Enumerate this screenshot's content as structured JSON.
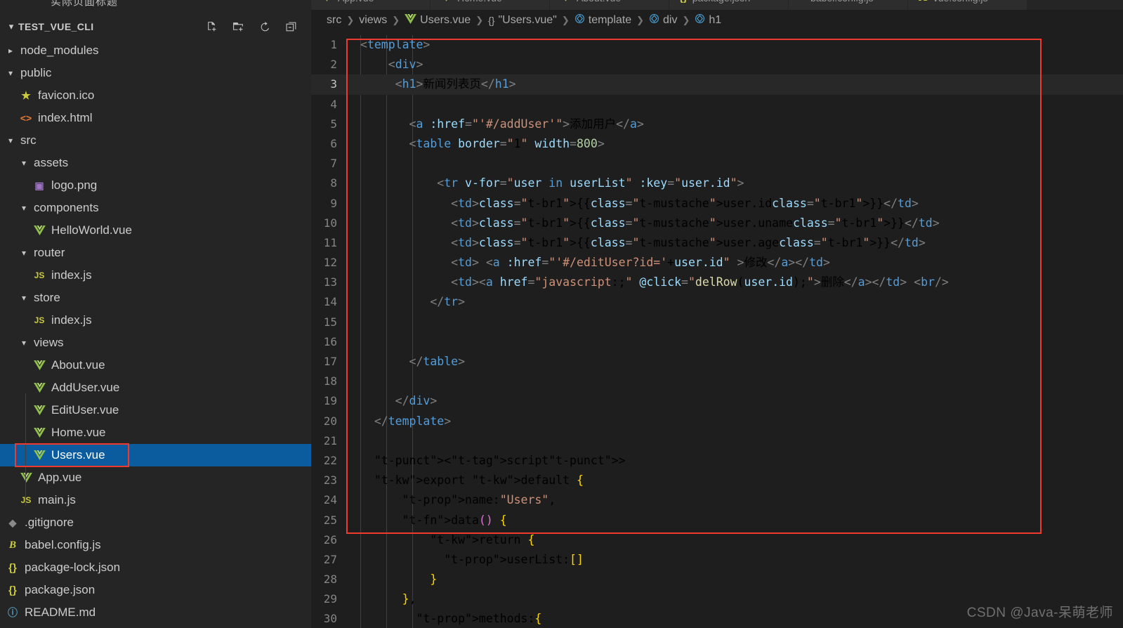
{
  "sidebar": {
    "cut_title": "实际页面标题",
    "project_name": "TEST_VUE_CLI",
    "actions": [
      {
        "name": "new-file",
        "label": "New File"
      },
      {
        "name": "new-folder",
        "label": "New Folder"
      },
      {
        "name": "refresh",
        "label": "Refresh Explorer"
      },
      {
        "name": "collapse",
        "label": "Collapse Folders in Explorer"
      }
    ],
    "items": [
      {
        "label": "node_modules",
        "kind": "folder",
        "expanded": false,
        "depth": 1,
        "icon": "chevron-right-icon"
      },
      {
        "label": "public",
        "kind": "folder",
        "expanded": true,
        "depth": 1,
        "icon": "chevron-down-icon"
      },
      {
        "label": "favicon.ico",
        "kind": "file",
        "depth": 2,
        "icon": "star-icon"
      },
      {
        "label": "index.html",
        "kind": "file",
        "depth": 2,
        "icon": "html-icon"
      },
      {
        "label": "src",
        "kind": "folder",
        "expanded": true,
        "depth": 1,
        "icon": "chevron-down-icon"
      },
      {
        "label": "assets",
        "kind": "folder",
        "expanded": true,
        "depth": 2,
        "icon": "chevron-down-icon"
      },
      {
        "label": "logo.png",
        "kind": "file",
        "depth": 3,
        "icon": "image-icon"
      },
      {
        "label": "components",
        "kind": "folder",
        "expanded": true,
        "depth": 2,
        "icon": "chevron-down-icon"
      },
      {
        "label": "HelloWorld.vue",
        "kind": "file",
        "depth": 3,
        "icon": "vue-icon"
      },
      {
        "label": "router",
        "kind": "folder",
        "expanded": true,
        "depth": 2,
        "icon": "chevron-down-icon"
      },
      {
        "label": "index.js",
        "kind": "file",
        "depth": 3,
        "icon": "js-icon"
      },
      {
        "label": "store",
        "kind": "folder",
        "expanded": true,
        "depth": 2,
        "icon": "chevron-down-icon"
      },
      {
        "label": "index.js",
        "kind": "file",
        "depth": 3,
        "icon": "js-icon"
      },
      {
        "label": "views",
        "kind": "folder",
        "expanded": true,
        "depth": 2,
        "icon": "chevron-down-icon"
      },
      {
        "label": "About.vue",
        "kind": "file",
        "depth": 3,
        "icon": "vue-icon"
      },
      {
        "label": "AddUser.vue",
        "kind": "file",
        "depth": 3,
        "icon": "vue-icon"
      },
      {
        "label": "EditUser.vue",
        "kind": "file",
        "depth": 3,
        "icon": "vue-icon"
      },
      {
        "label": "Home.vue",
        "kind": "file",
        "depth": 3,
        "icon": "vue-icon"
      },
      {
        "label": "Users.vue",
        "kind": "file",
        "depth": 3,
        "icon": "vue-icon",
        "selected": true,
        "annotated": true
      },
      {
        "label": "App.vue",
        "kind": "file",
        "depth": 2,
        "icon": "vue-icon"
      },
      {
        "label": "main.js",
        "kind": "file",
        "depth": 2,
        "icon": "js-icon"
      },
      {
        "label": ".gitignore",
        "kind": "file",
        "depth": 1,
        "icon": "git-icon"
      },
      {
        "label": "babel.config.js",
        "kind": "file",
        "depth": 1,
        "icon": "babel-icon"
      },
      {
        "label": "package-lock.json",
        "kind": "file",
        "depth": 1,
        "icon": "json-icon"
      },
      {
        "label": "package.json",
        "kind": "file",
        "depth": 1,
        "icon": "json-icon"
      },
      {
        "label": "README.md",
        "kind": "file",
        "depth": 1,
        "icon": "markdown-icon"
      }
    ]
  },
  "tabs": [
    {
      "label": "App.vue",
      "icon": "vue-icon",
      "active": false
    },
    {
      "label": "Home.vue",
      "icon": "vue-icon",
      "active": false
    },
    {
      "label": "About.vue",
      "icon": "vue-icon",
      "active": false
    },
    {
      "label": "package.json",
      "icon": "json-icon",
      "active": false
    },
    {
      "label": "babel.config.js",
      "icon": "babel-icon",
      "active": false
    },
    {
      "label": "vue.config.js",
      "icon": "js-icon",
      "active": false
    }
  ],
  "breadcrumb": [
    {
      "label": "src",
      "icon": null
    },
    {
      "label": "views",
      "icon": null
    },
    {
      "label": "Users.vue",
      "icon": "vue-icon"
    },
    {
      "label": "\"Users.vue\"",
      "icon": "json-icon"
    },
    {
      "label": "template",
      "icon": "tag-icon"
    },
    {
      "label": "div",
      "icon": "tag-icon"
    },
    {
      "label": "h1",
      "icon": "tag-icon"
    }
  ],
  "editor": {
    "active_line": 3,
    "lines": [
      {
        "n": 1,
        "text": "<template>"
      },
      {
        "n": 2,
        "text": "    <div>"
      },
      {
        "n": 3,
        "text": "     <h1>新闻列表页</h1>"
      },
      {
        "n": 4,
        "text": ""
      },
      {
        "n": 5,
        "text": "       <a :href=\"'#/addUser'\">添加用户</a>"
      },
      {
        "n": 6,
        "text": "       <table border=\"1\" width=800>"
      },
      {
        "n": 7,
        "text": ""
      },
      {
        "n": 8,
        "text": "           <tr v-for=\"user in userList\" :key=\"user.id\">"
      },
      {
        "n": 9,
        "text": "             <td>{{user.id}}</td>"
      },
      {
        "n": 10,
        "text": "             <td>{{user.uname}}</td>"
      },
      {
        "n": 11,
        "text": "             <td>{{user.age}}</td>"
      },
      {
        "n": 12,
        "text": "             <td> <a :href=\"'#/editUser?id='+user.id\" >修改</a></td>"
      },
      {
        "n": 13,
        "text": "             <td><a href=\"javascript:;\" @click=\"delRow(user.id);\">删除</a></td> <br/>"
      },
      {
        "n": 14,
        "text": "          </tr>"
      },
      {
        "n": 15,
        "text": ""
      },
      {
        "n": 16,
        "text": ""
      },
      {
        "n": 17,
        "text": "       </table>"
      },
      {
        "n": 18,
        "text": ""
      },
      {
        "n": 19,
        "text": "     </div>"
      },
      {
        "n": 20,
        "text": "  </template>"
      },
      {
        "n": 21,
        "text": ""
      },
      {
        "n": 22,
        "text": "  <script>"
      },
      {
        "n": 23,
        "text": "  export default {"
      },
      {
        "n": 24,
        "text": "      name:\"Users\","
      },
      {
        "n": 25,
        "text": "      data() {"
      },
      {
        "n": 26,
        "text": "          return {"
      },
      {
        "n": 27,
        "text": "            userList:[]"
      },
      {
        "n": 28,
        "text": "          }"
      },
      {
        "n": 29,
        "text": "      },"
      },
      {
        "n": 30,
        "text": "        methods:{"
      }
    ]
  },
  "annotations": {
    "code_box": {
      "color": "#f03a2e"
    },
    "sidebar_box": {
      "color": "#f03a2e"
    }
  },
  "watermark": "CSDN @Java-呆萌老师",
  "colors": {
    "sidebar_bg": "#252526",
    "editor_bg": "#1e1e1e",
    "selection_blue": "#0a5c9e",
    "annotation_red": "#f03a2e",
    "vue_green": "#8dc149",
    "json_yellow": "#cbcb41"
  }
}
